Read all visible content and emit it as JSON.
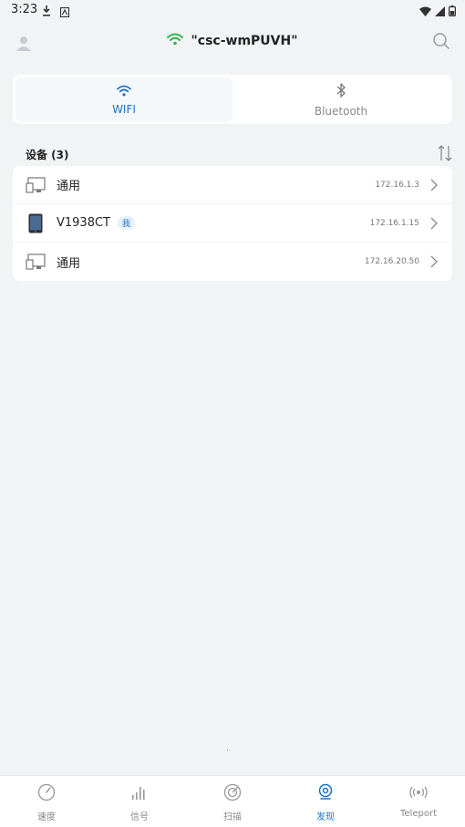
{
  "status_bar": {
    "time": "3:23"
  },
  "header": {
    "ssid": "\"csc-wmPUVH\""
  },
  "tabs": [
    {
      "label": "WIFI",
      "active": true
    },
    {
      "label": "Bluetooth",
      "active": false
    }
  ],
  "devices": {
    "title": "设备 (3)",
    "items": [
      {
        "name": "通用",
        "ip": "172.16.1.3"
      },
      {
        "name": "V1938CT",
        "badge": "我",
        "ip": "172.16.1.15"
      },
      {
        "name": "通用",
        "ip": "172.16.20.50"
      }
    ]
  },
  "bottom_nav": [
    {
      "label": "速度"
    },
    {
      "label": "信号"
    },
    {
      "label": "扫描"
    },
    {
      "label": "发现",
      "active": true
    },
    {
      "label": "Teleport"
    }
  ],
  "colors": {
    "accent": "#1a73c8",
    "wifi_green": "#2db84d",
    "background": "#f2f3f5"
  }
}
